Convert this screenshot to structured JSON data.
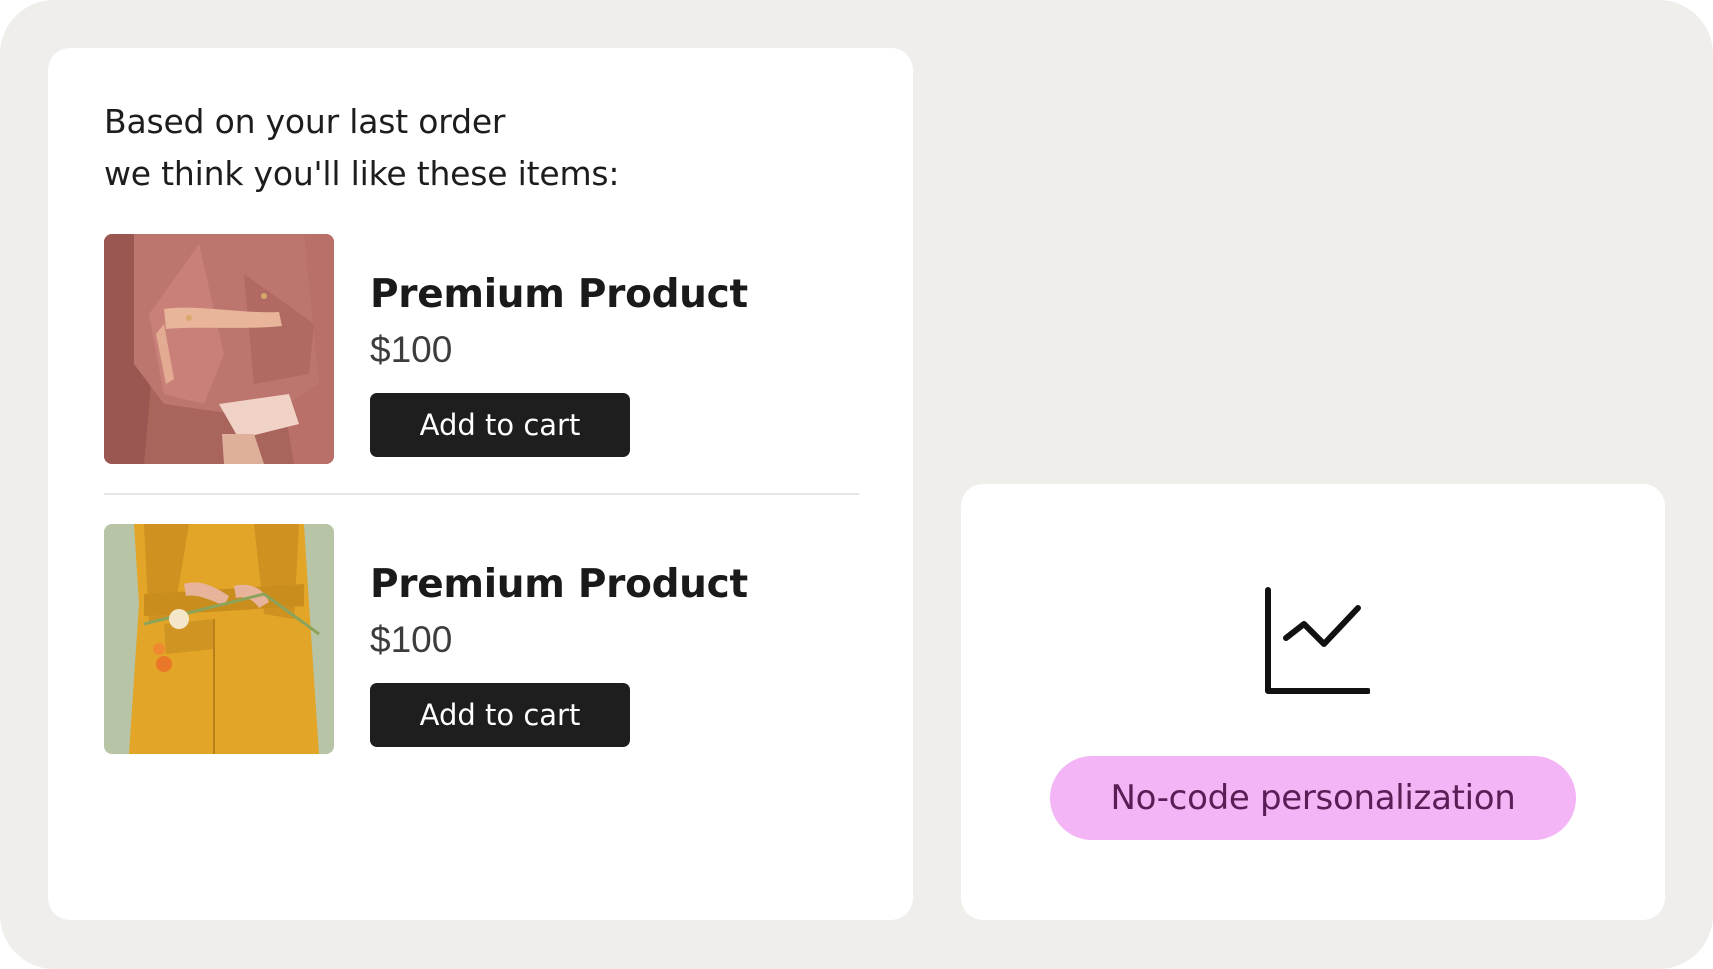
{
  "recommendations": {
    "heading_line1": "Based on your last order",
    "heading_line2": "we think you'll like these items:",
    "products": [
      {
        "name": "Premium Product",
        "price": "$100",
        "button_label": "Add to cart",
        "image": "woman-in-mauve-blazer-photo"
      },
      {
        "name": "Premium Product",
        "price": "$100",
        "button_label": "Add to cart",
        "image": "woman-in-mustard-coat-with-flowers-photo"
      }
    ]
  },
  "feature": {
    "icon": "line-chart-icon",
    "badge_label": "No-code personalization"
  },
  "colors": {
    "background": "#efeeeb",
    "card": "#ffffff",
    "button": "#1e1e1e",
    "badge_background": "#f3b5f5",
    "badge_text": "#5a1d55"
  }
}
